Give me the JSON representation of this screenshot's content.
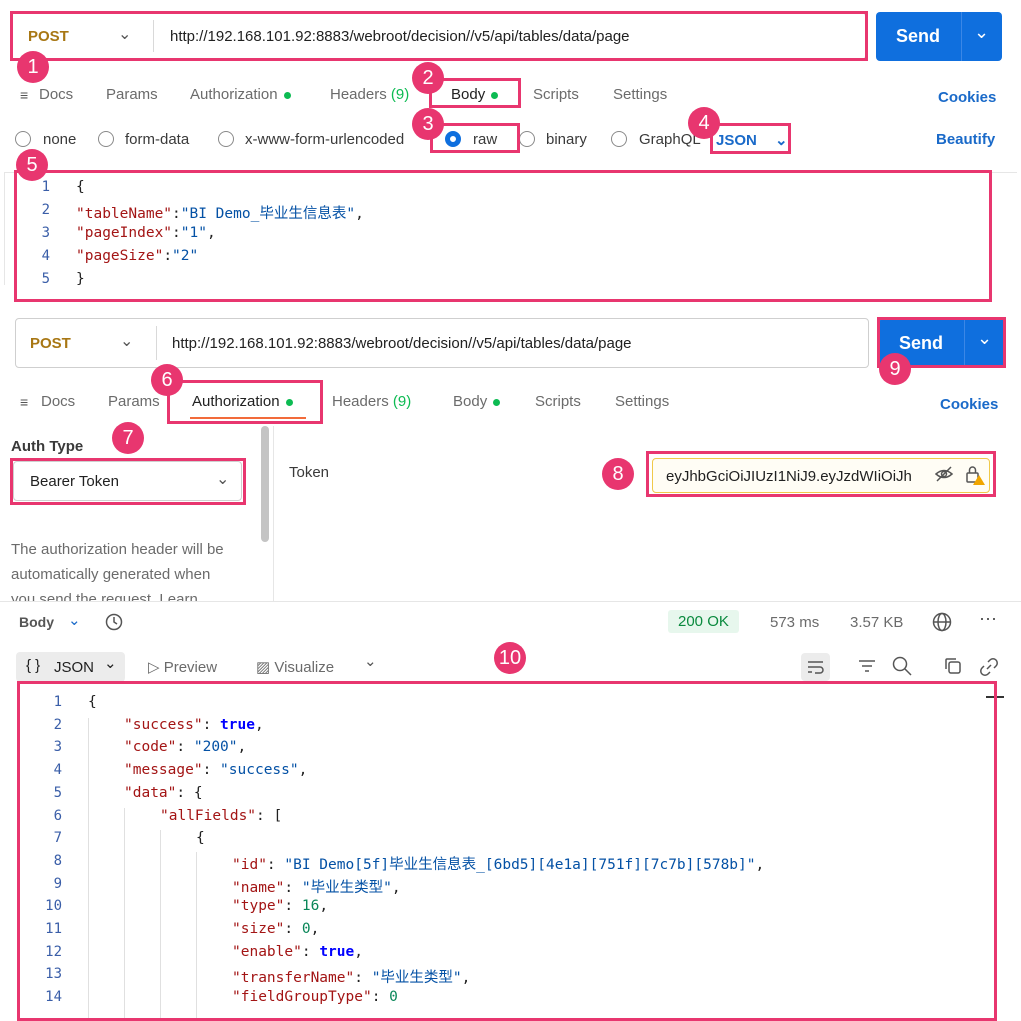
{
  "request1": {
    "method": "POST",
    "url": "http://192.168.101.92:8883/webroot/decision//v5/api/tables/data/page",
    "send_label": "Send",
    "tabs": {
      "docs": "Docs",
      "params": "Params",
      "authorization": "Authorization",
      "headers": "Headers",
      "headers_count": "(9)",
      "body": "Body",
      "scripts": "Scripts",
      "settings": "Settings"
    },
    "cookies": "Cookies",
    "body_types": {
      "none": "none",
      "form_data": "form-data",
      "urlencoded": "x-www-form-urlencoded",
      "raw": "raw",
      "binary": "binary",
      "graphql": "GraphQL"
    },
    "format": "JSON",
    "beautify": "Beautify",
    "body_lines": [
      {
        "num": "1",
        "text": "{"
      },
      {
        "num": "2",
        "key": "\"tableName\"",
        "val": "\"BI Demo_毕业生信息表\"",
        "tail": ","
      },
      {
        "num": "3",
        "key": "\"pageIndex\"",
        "val": "\"1\"",
        "tail": ","
      },
      {
        "num": "4",
        "key": "\"pageSize\"",
        "val": "\"2\"",
        "tail": ""
      },
      {
        "num": "5",
        "text": "}"
      }
    ]
  },
  "request2": {
    "method": "POST",
    "url": "http://192.168.101.92:8883/webroot/decision//v5/api/tables/data/page",
    "send_label": "Send",
    "tabs": {
      "docs": "Docs",
      "params": "Params",
      "authorization": "Authorization",
      "headers": "Headers",
      "headers_count": "(9)",
      "body": "Body",
      "scripts": "Scripts",
      "settings": "Settings"
    },
    "cookies": "Cookies",
    "auth_type_label": "Auth Type",
    "auth_type_value": "Bearer Token",
    "auth_help_1": "The authorization header will be",
    "auth_help_2": "automatically generated when",
    "auth_help_3": "you send the request. Learn",
    "token_label": "Token",
    "token_value": "eyJhbGciOiJIUzI1NiJ9.eyJzdWIiOiJh"
  },
  "response": {
    "body_label": "Body",
    "status": "200 OK",
    "time": "573 ms",
    "size": "3.57 KB",
    "format": "JSON",
    "preview": "Preview",
    "visualize": "Visualize",
    "lines": [
      {
        "num": "1",
        "indent": 0,
        "parts": [
          {
            "t": "p",
            "v": "{"
          }
        ]
      },
      {
        "num": "2",
        "indent": 1,
        "parts": [
          {
            "t": "k",
            "v": "\"success\""
          },
          {
            "t": "p",
            "v": ": "
          },
          {
            "t": "b",
            "v": "true"
          },
          {
            "t": "p",
            "v": ","
          }
        ]
      },
      {
        "num": "3",
        "indent": 1,
        "parts": [
          {
            "t": "k",
            "v": "\"code\""
          },
          {
            "t": "p",
            "v": ": "
          },
          {
            "t": "s",
            "v": "\"200\""
          },
          {
            "t": "p",
            "v": ","
          }
        ]
      },
      {
        "num": "4",
        "indent": 1,
        "parts": [
          {
            "t": "k",
            "v": "\"message\""
          },
          {
            "t": "p",
            "v": ": "
          },
          {
            "t": "s",
            "v": "\"success\""
          },
          {
            "t": "p",
            "v": ","
          }
        ]
      },
      {
        "num": "5",
        "indent": 1,
        "parts": [
          {
            "t": "k",
            "v": "\"data\""
          },
          {
            "t": "p",
            "v": ": {"
          }
        ]
      },
      {
        "num": "6",
        "indent": 2,
        "parts": [
          {
            "t": "k",
            "v": "\"allFields\""
          },
          {
            "t": "p",
            "v": ": ["
          }
        ]
      },
      {
        "num": "7",
        "indent": 3,
        "parts": [
          {
            "t": "p",
            "v": "{"
          }
        ]
      },
      {
        "num": "8",
        "indent": 4,
        "parts": [
          {
            "t": "k",
            "v": "\"id\""
          },
          {
            "t": "p",
            "v": ": "
          },
          {
            "t": "s",
            "v": "\"BI Demo[5f]毕业生信息表_[6bd5][4e1a][751f][7c7b][578b]\""
          },
          {
            "t": "p",
            "v": ","
          }
        ]
      },
      {
        "num": "9",
        "indent": 4,
        "parts": [
          {
            "t": "k",
            "v": "\"name\""
          },
          {
            "t": "p",
            "v": ": "
          },
          {
            "t": "s",
            "v": "\"毕业生类型\""
          },
          {
            "t": "p",
            "v": ","
          }
        ]
      },
      {
        "num": "10",
        "indent": 4,
        "parts": [
          {
            "t": "k",
            "v": "\"type\""
          },
          {
            "t": "p",
            "v": ": "
          },
          {
            "t": "n",
            "v": "16"
          },
          {
            "t": "p",
            "v": ","
          }
        ]
      },
      {
        "num": "11",
        "indent": 4,
        "parts": [
          {
            "t": "k",
            "v": "\"size\""
          },
          {
            "t": "p",
            "v": ": "
          },
          {
            "t": "n",
            "v": "0"
          },
          {
            "t": "p",
            "v": ","
          }
        ]
      },
      {
        "num": "12",
        "indent": 4,
        "parts": [
          {
            "t": "k",
            "v": "\"enable\""
          },
          {
            "t": "p",
            "v": ": "
          },
          {
            "t": "b",
            "v": "true"
          },
          {
            "t": "p",
            "v": ","
          }
        ]
      },
      {
        "num": "13",
        "indent": 4,
        "parts": [
          {
            "t": "k",
            "v": "\"transferName\""
          },
          {
            "t": "p",
            "v": ": "
          },
          {
            "t": "s",
            "v": "\"毕业生类型\""
          },
          {
            "t": "p",
            "v": ","
          }
        ]
      },
      {
        "num": "14",
        "indent": 4,
        "parts": [
          {
            "t": "k",
            "v": "\"fieldGroupType\""
          },
          {
            "t": "p",
            "v": ": "
          },
          {
            "t": "n",
            "v": "0"
          }
        ]
      }
    ]
  },
  "annotations": [
    "1",
    "2",
    "3",
    "4",
    "5",
    "6",
    "7",
    "8",
    "9",
    "10"
  ]
}
